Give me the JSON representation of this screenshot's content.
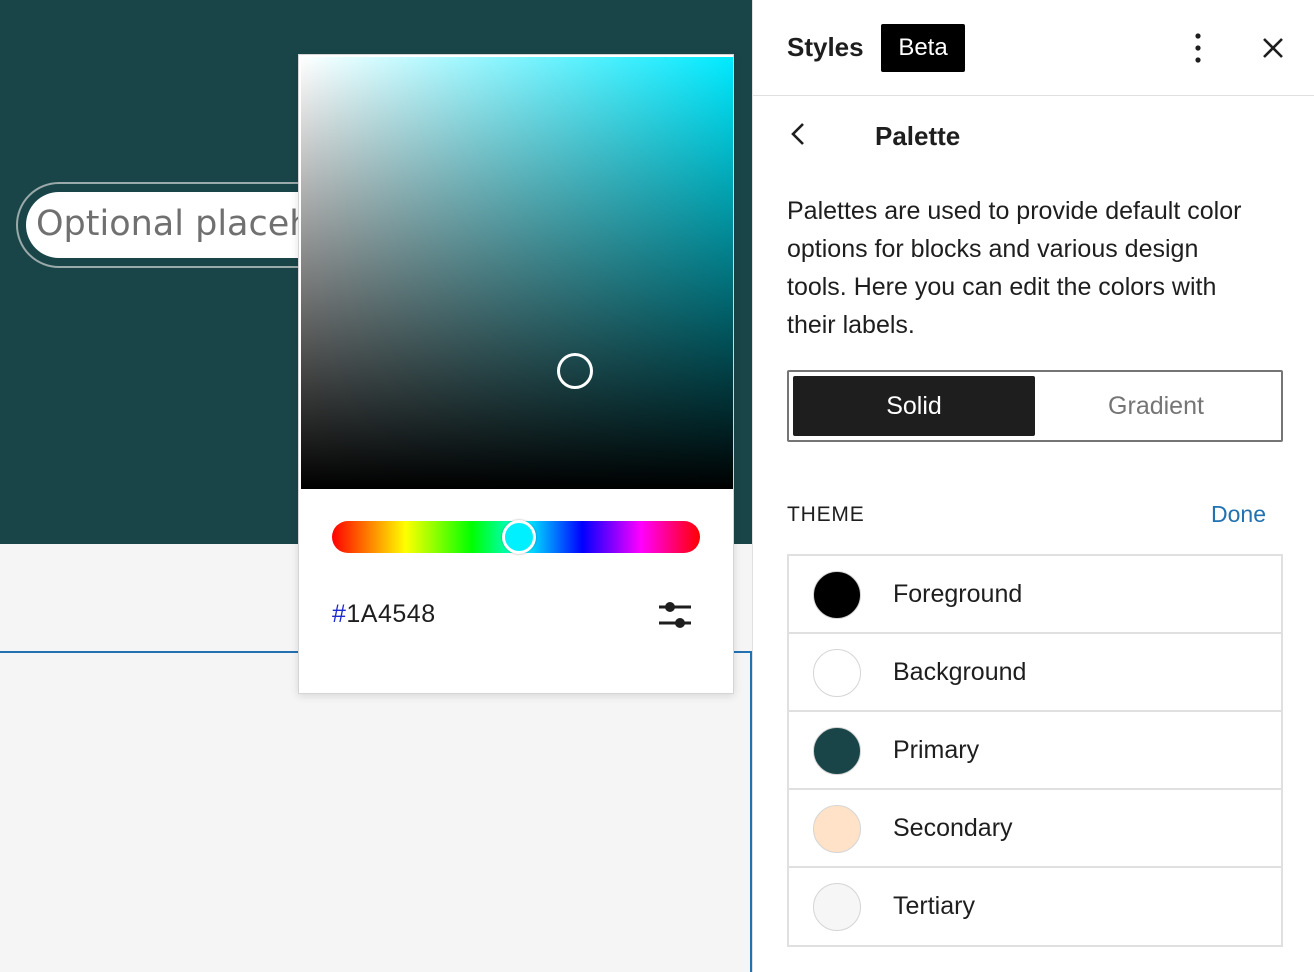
{
  "canvas": {
    "hero_color": "#1a4548",
    "search_placeholder": "Optional placeholder…"
  },
  "color_picker": {
    "hue_color": "#00eaff",
    "hex_hash": "#",
    "hex_value": "1A4548",
    "settings_icon": "sliders-icon"
  },
  "sidebar": {
    "title": "Styles",
    "badge": "Beta",
    "more_icon": "more-vertical-icon",
    "close_icon": "close-icon",
    "back_icon": "chevron-left-icon",
    "nav_title": "Palette",
    "description": "Palettes are used to provide default color options for blocks and various design tools. Here you can edit the colors with their labels.",
    "segments": {
      "solid": "Solid",
      "gradient": "Gradient",
      "selected": "Solid"
    },
    "theme_label": "THEME",
    "done_label": "Done",
    "palette": [
      {
        "name": "Foreground",
        "color": "#000000"
      },
      {
        "name": "Background",
        "color": "#ffffff"
      },
      {
        "name": "Primary",
        "color": "#1a4548"
      },
      {
        "name": "Secondary",
        "color": "#ffe2c7"
      },
      {
        "name": "Tertiary",
        "color": "#f6f6f6"
      }
    ]
  }
}
